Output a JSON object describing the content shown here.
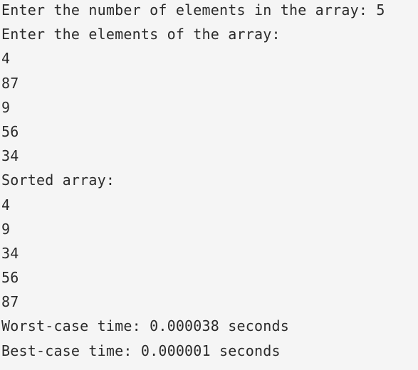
{
  "console": {
    "lines": [
      "Enter the number of elements in the array: 5",
      "Enter the elements of the array:",
      "4",
      "87",
      "9",
      "56",
      "34",
      "Sorted array:",
      "4",
      "9",
      "34",
      "56",
      "87",
      "Worst-case time: 0.000038 seconds",
      "Best-case time: 0.000001 seconds"
    ]
  },
  "colors": {
    "background": "#f5f5f5",
    "text": "#2b2b2b"
  }
}
